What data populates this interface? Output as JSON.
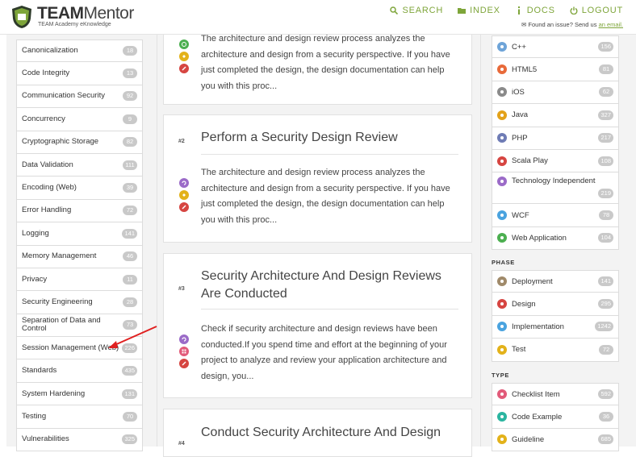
{
  "header": {
    "brand_team": "TEAM",
    "brand_mentor": "Mentor",
    "tagline": "TEAM Academy eKnowledge",
    "nav": [
      {
        "label": "SEARCH",
        "icon": "search-icon"
      },
      {
        "label": "INDEX",
        "icon": "folder-icon"
      },
      {
        "label": "DOCS",
        "icon": "docs-icon"
      },
      {
        "label": "LOGOUT",
        "icon": "power-icon"
      }
    ],
    "issue_text": "Found an issue? Send us",
    "issue_link": "an email."
  },
  "left_list": [
    {
      "label": "Canonicalization",
      "count": "18"
    },
    {
      "label": "Code Integrity",
      "count": "13"
    },
    {
      "label": "Communication Security",
      "count": "92"
    },
    {
      "label": "Concurrency",
      "count": "9"
    },
    {
      "label": "Cryptographic Storage",
      "count": "82"
    },
    {
      "label": "Data Validation",
      "count": "111"
    },
    {
      "label": "Encoding (Web)",
      "count": "39"
    },
    {
      "label": "Error Handling",
      "count": "72"
    },
    {
      "label": "Logging",
      "count": "141"
    },
    {
      "label": "Memory Management",
      "count": "46"
    },
    {
      "label": "Privacy",
      "count": "11"
    },
    {
      "label": "Security Engineering",
      "count": "28"
    },
    {
      "label": "Separation of Data and Control",
      "count": "73"
    },
    {
      "label": "Session Management (Web)",
      "count": "226"
    },
    {
      "label": "Standards",
      "count": "435"
    },
    {
      "label": "System Hardening",
      "count": "131"
    },
    {
      "label": "Testing",
      "count": "70"
    },
    {
      "label": "Vulnerabilities",
      "count": "325"
    }
  ],
  "cards": [
    {
      "num": "",
      "title": "",
      "body": "The architecture and design review process analyzes the architecture and design from a security perspective. If you have just completed the design, the design documentation can help you with this proc..."
    },
    {
      "num": "#2",
      "title": "Perform a Security Design Review",
      "body": "The architecture and design review process analyzes the architecture and design from a security perspective. If you have just completed the design, the design documentation can help you with this proc..."
    },
    {
      "num": "#3",
      "title": "Security Architecture And Design Reviews Are Conducted",
      "body": "Check if security architecture and design reviews have been conducted.If you spend time and effort at the beginning of your project to analyze and review your application architecture and design, you..."
    },
    {
      "num": "#4",
      "title": "Conduct Security Architecture And Design",
      "body": ""
    }
  ],
  "technology": [
    {
      "label": "C++",
      "count": "156",
      "icon": "cpp-icon",
      "color": "#6ea4d8"
    },
    {
      "label": "HTML5",
      "count": "81",
      "icon": "html5-icon",
      "color": "#e86a3a"
    },
    {
      "label": "iOS",
      "count": "62",
      "icon": "apple-icon",
      "color": "#8a8a8a"
    },
    {
      "label": "Java",
      "count": "327",
      "icon": "java-icon",
      "color": "#e3a21a"
    },
    {
      "label": "PHP",
      "count": "217",
      "icon": "php-icon",
      "color": "#6f7cb5"
    },
    {
      "label": "Scala Play",
      "count": "108",
      "icon": "scala-icon",
      "color": "#d64541"
    },
    {
      "label": "Technology Independent",
      "count": "219",
      "icon": "tech-independent-icon",
      "color": "#9b6bc8"
    },
    {
      "label": "WCF",
      "count": "78",
      "icon": "windows-icon",
      "color": "#4aa3df"
    },
    {
      "label": "Web Application",
      "count": "104",
      "icon": "globe-icon",
      "color": "#4caf50"
    }
  ],
  "phase_heading": "PHASE",
  "phase": [
    {
      "label": "Deployment",
      "count": "141",
      "icon": "deploy-icon",
      "color": "#a08a6a"
    },
    {
      "label": "Design",
      "count": "295",
      "icon": "design-icon",
      "color": "#d64541"
    },
    {
      "label": "Implementation",
      "count": "1242",
      "icon": "implementation-icon",
      "color": "#4aa3df"
    },
    {
      "label": "Test",
      "count": "72",
      "icon": "test-icon",
      "color": "#e3b21a"
    }
  ],
  "type_heading": "TYPE",
  "type": [
    {
      "label": "Checklist Item",
      "count": "592",
      "icon": "checklist-icon",
      "color": "#e25b7a"
    },
    {
      "label": "Code Example",
      "count": "36",
      "icon": "code-icon",
      "color": "#2bb5a0"
    },
    {
      "label": "Guideline",
      "count": "685",
      "icon": "guideline-icon",
      "color": "#e3b21a"
    }
  ],
  "colors": {
    "accent": "#7ea53a",
    "annotation_arrow": "#e02020"
  }
}
